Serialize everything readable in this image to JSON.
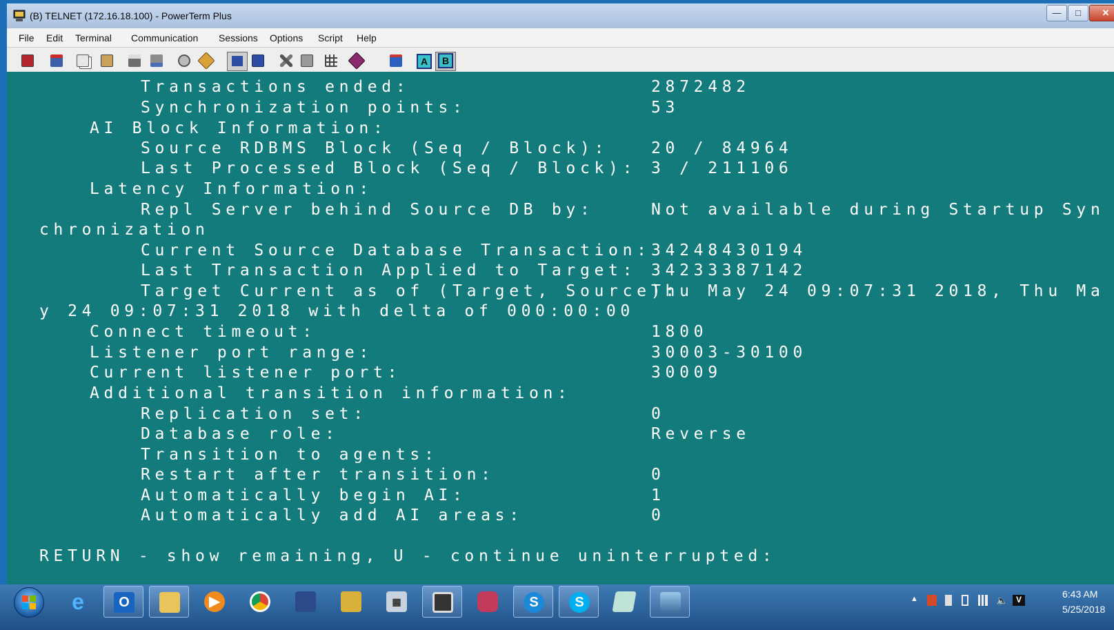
{
  "window": {
    "title": "(B) TELNET (172.16.18.100) - PowerTerm Plus"
  },
  "menu": [
    "File",
    "Edit",
    "Terminal",
    "Communication",
    "Sessions",
    "Options",
    "Script",
    "Help"
  ],
  "toolbar": {
    "icons": [
      "exit-icon",
      "connect-icon",
      "copy-icon",
      "paste-icon",
      "print-icon",
      "capture-icon",
      "macro-icon",
      "run-script-icon",
      "80-columns-icon",
      "132-columns-icon",
      "tools-icon",
      "keyboard-icon",
      "grid-icon",
      "book-icon",
      "new-session-icon"
    ],
    "session_a": "A",
    "session_b": "B"
  },
  "terminal": {
    "lines": [
      {
        "label": "Transactions ended:",
        "value": "2872482"
      },
      {
        "label": "Synchronization points:",
        "value": "53"
      },
      {
        "label": "AI Block Information:",
        "value": ""
      },
      {
        "label": "Source RDBMS Block (Seq / Block):",
        "value": "20 / 84964"
      },
      {
        "label": "Last Processed Block (Seq / Block):",
        "value": "3 / 211106"
      },
      {
        "label": "Latency Information:",
        "value": ""
      },
      {
        "label": "Repl Server behind Source DB by:",
        "value": "Not available during Startup Syn"
      },
      {
        "label": "chronization",
        "value": ""
      },
      {
        "label": "Current Source Database Transaction:",
        "value": "34248430194"
      },
      {
        "label": "Last Transaction Applied to Target:",
        "value": "34233387142"
      },
      {
        "label": "Target Current as of (Target, Source):",
        "value": "Thu May 24 09:07:31 2018, Thu Ma"
      },
      {
        "label": "y 24 09:07:31 2018 with delta of 000:00:00",
        "value": ""
      },
      {
        "label": "Connect timeout:",
        "value": "1800"
      },
      {
        "label": "Listener port range:",
        "value": "30003-30100"
      },
      {
        "label": "Current listener port:",
        "value": "30009"
      },
      {
        "label": "Additional transition information:",
        "value": ""
      },
      {
        "label": "Replication set:",
        "value": "0"
      },
      {
        "label": "Database role:",
        "value": "Reverse"
      },
      {
        "label": "Transition to agents:",
        "value": ""
      },
      {
        "label": "Restart after transition:",
        "value": "0"
      },
      {
        "label": "Automatically begin AI:",
        "value": "1"
      },
      {
        "label": "Automatically add AI areas:",
        "value": "0"
      }
    ],
    "prompt": "RETURN - show remaining, U - continue uninterrupted:"
  },
  "taskbar": {
    "apps": [
      "internet-explorer",
      "outlook",
      "file-explorer",
      "media-player",
      "chrome",
      "remote-desktop",
      "network-tool",
      "calculator",
      "powerterm",
      "database-tool",
      "skype-business",
      "skype",
      "notepad",
      "photo-viewer"
    ],
    "active_app": "powerterm",
    "time": "6:43 AM",
    "date": "5/25/2018"
  }
}
